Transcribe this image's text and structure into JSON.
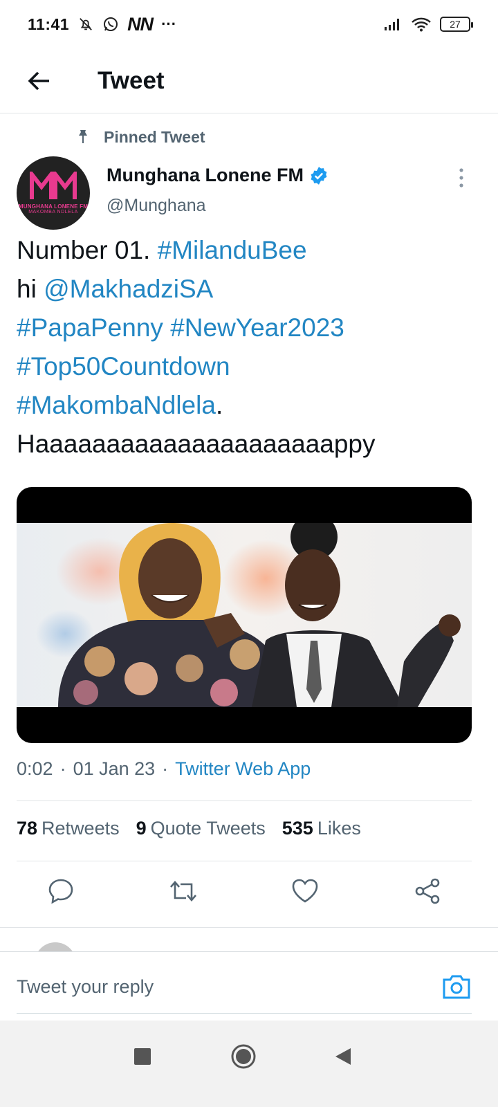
{
  "status_bar": {
    "time": "11:41",
    "carrier_logo": "NN",
    "more": "···",
    "battery": "27",
    "icons": [
      "mute-bell-icon",
      "whatsapp-icon",
      "signal-icon",
      "wifi-icon",
      "battery-icon"
    ]
  },
  "header": {
    "back_icon": "arrow-left-icon",
    "title": "Tweet"
  },
  "tweet": {
    "pinned_label": "Pinned Tweet",
    "author_name": "Munghana Lonene FM",
    "author_handle": "@Munghana",
    "verified": true,
    "avatar_text_1": "MUNGHANA LONENE FM",
    "avatar_text_2": "MAKOMBA NDLELA",
    "text": {
      "l1_plain": "Number 01. ",
      "l1_tag": "#MilanduBee",
      "l2_plain": "hi ",
      "l2_mention": "@MakhadziSA",
      "l3_tag1": "#PapaPenny",
      "l3_tag2": "#NewYear2023",
      "l4_tag": "#Top50Countdown",
      "l5_tag": "#MakombaNdlela",
      "l5_plain": ".",
      "l6_plain": "Haaaaaaaaaaaaaaaaaaaaappy"
    },
    "time": "0:02",
    "date": "01 Jan 23",
    "separator": "·",
    "source": "Twitter Web App"
  },
  "stats": {
    "retweets_count": "78",
    "retweets_label": "Retweets",
    "quotes_count": "9",
    "quotes_label": "Quote Tweets",
    "likes_count": "535",
    "likes_label": "Likes"
  },
  "actions": [
    "reply-icon",
    "retweet-icon",
    "like-icon",
    "share-icon"
  ],
  "reply_bar": {
    "placeholder": "Tweet your reply"
  },
  "colors": {
    "link": "#2286c3",
    "verified": "#1d9bf0",
    "secondary_text": "#536471",
    "avatar_accent": "#e83a8f"
  }
}
